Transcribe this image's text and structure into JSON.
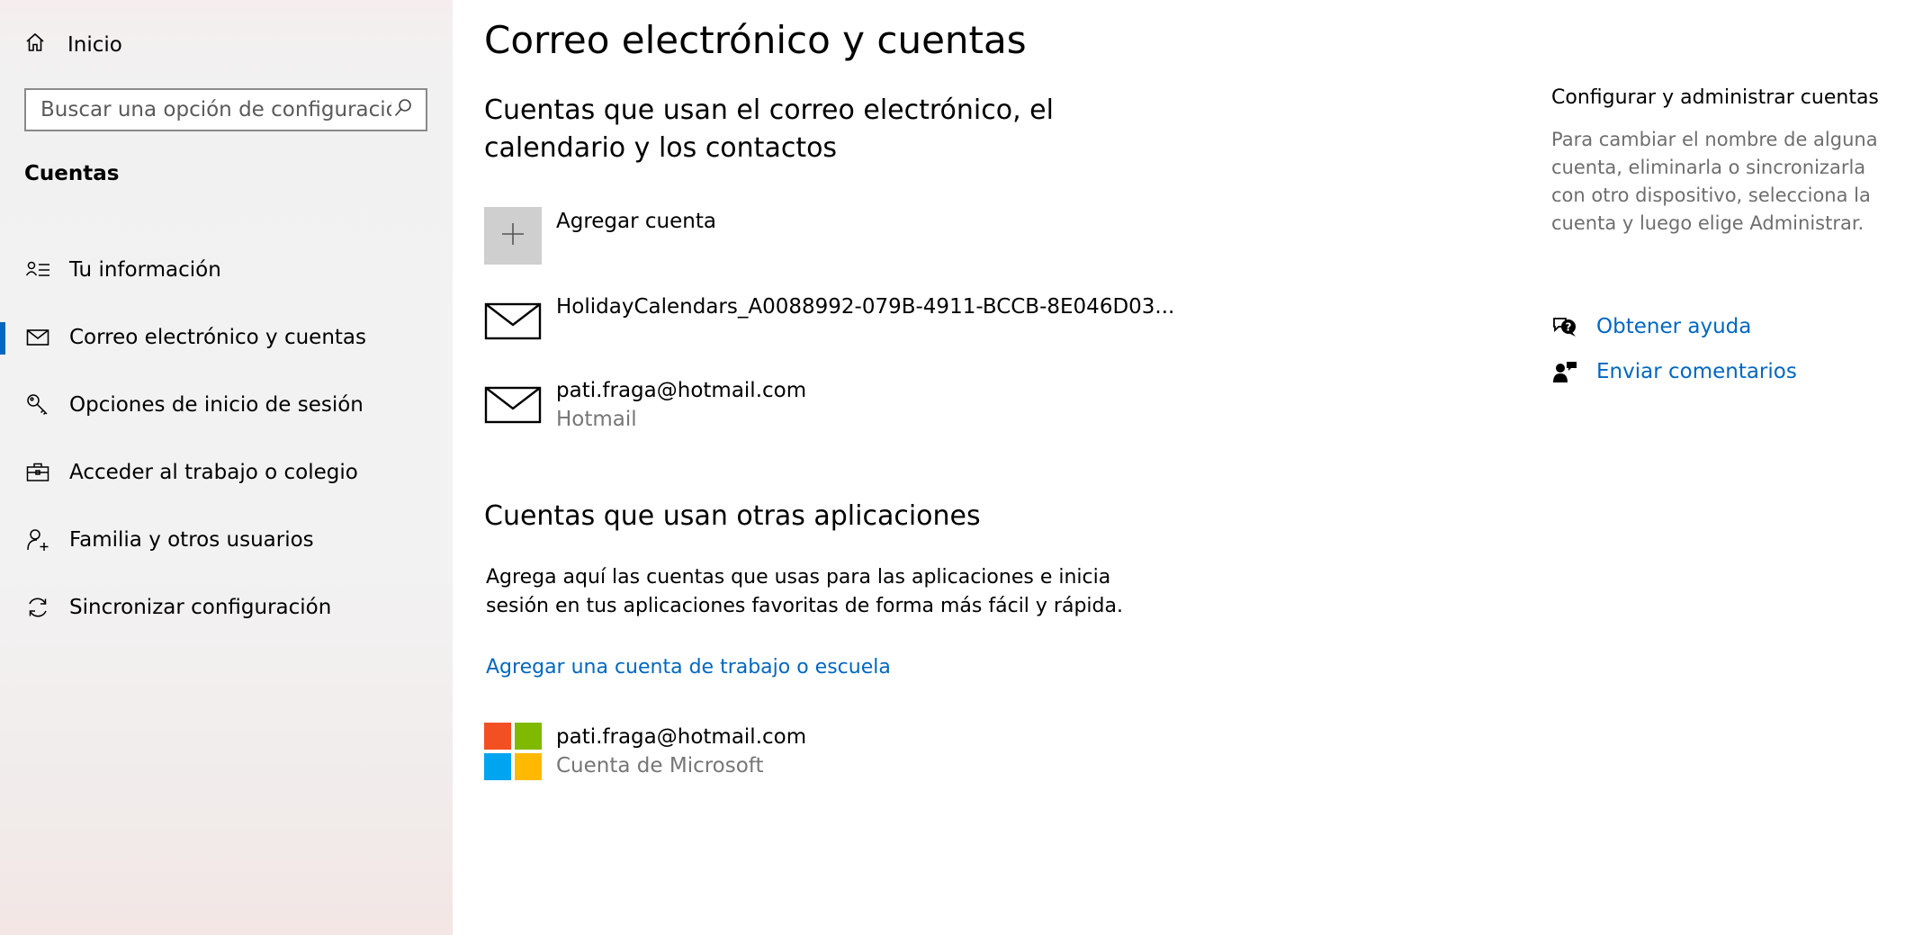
{
  "sidebar": {
    "home_label": "Inicio",
    "search_placeholder": "Buscar una opción de configuración",
    "section_title": "Cuentas",
    "items": [
      {
        "label": "Tu información",
        "icon": "person-info-icon"
      },
      {
        "label": "Correo electrónico y cuentas",
        "icon": "mail-icon",
        "active": true
      },
      {
        "label": "Opciones de inicio de sesión",
        "icon": "key-icon"
      },
      {
        "label": "Acceder al trabajo o colegio",
        "icon": "briefcase-icon"
      },
      {
        "label": "Familia y otros usuarios",
        "icon": "add-person-icon"
      },
      {
        "label": "Sincronizar configuración",
        "icon": "sync-icon"
      }
    ],
    "accent_color": "#0067c0"
  },
  "main": {
    "title": "Correo electrónico y cuentas",
    "email_section": {
      "heading_line1": "Cuentas que usan el correo electrónico, el",
      "heading_line2": "calendario y los contactos",
      "add_account_label": "Agregar cuenta",
      "accounts": [
        {
          "name": "HolidayCalendars_A0088992-079B-4911-BCCB-8E046D03...",
          "sub": ""
        },
        {
          "name": "pati.fraga@hotmail.com",
          "sub": "Hotmail"
        }
      ]
    },
    "other_apps_section": {
      "heading": "Cuentas que usan otras aplicaciones",
      "description_line1": "Agrega aquí las cuentas que usas para las aplicaciones e inicia",
      "description_line2": "sesión en tus aplicaciones favoritas de forma más fácil y rápida.",
      "add_work_link": "Agregar una cuenta de trabajo o escuela",
      "account": {
        "name": "pati.fraga@hotmail.com",
        "sub": "Cuenta de Microsoft"
      },
      "logo_colors": [
        "#f25022",
        "#7fba00",
        "#00a4ef",
        "#ffb900"
      ]
    }
  },
  "right_pane": {
    "title": "Configurar y administrar cuentas",
    "description": "Para cambiar el nombre de alguna cuenta, eliminarla o sincronizarla con otro dispositivo, selecciona la cuenta y luego elige Administrar.",
    "help_link": "Obtener ayuda",
    "feedback_link": "Enviar comentarios"
  }
}
